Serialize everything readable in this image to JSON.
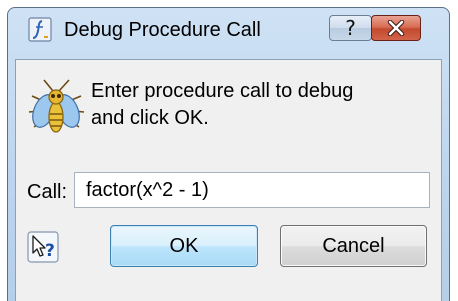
{
  "window": {
    "title": "Debug Procedure Call"
  },
  "titlebar": {
    "help_glyph": "?",
    "close_glyph": "x"
  },
  "dialog": {
    "prompt": "Enter procedure call to debug\nand click OK.",
    "call_label": "Call:",
    "call_value": "factor(x^2 - 1)"
  },
  "buttons": {
    "ok": "OK",
    "cancel": "Cancel"
  },
  "icons": {
    "app": "maple-app-icon",
    "debug": "fly-bug-icon",
    "help": "context-help-icon"
  },
  "colors": {
    "close_button": "#c9533a",
    "default_button_border": "#3c7fb1",
    "window_frame": "#bcd4ee"
  }
}
